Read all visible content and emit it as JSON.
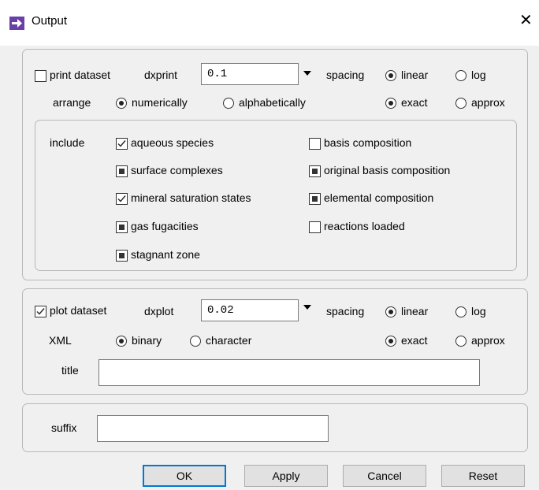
{
  "window": {
    "title": "Output",
    "close_glyph": "✕"
  },
  "print": {
    "checkbox_label": "print dataset",
    "checked": false,
    "dx_label": "dxprint",
    "dx_value": "0.1",
    "spacing_label": "spacing",
    "spacing_options": [
      "linear",
      "log"
    ],
    "spacing_selected": "linear",
    "arrange_label": "arrange",
    "arrange_options": [
      "numerically",
      "alphabetically"
    ],
    "arrange_selected": "numerically",
    "precision_options": [
      "exact",
      "approx"
    ],
    "precision_selected": "exact",
    "include_label": "include",
    "include_items": [
      {
        "label": "aqueous species",
        "state": "checked"
      },
      {
        "label": "basis composition",
        "state": "unchecked"
      },
      {
        "label": "surface complexes",
        "state": "filled"
      },
      {
        "label": "original basis composition",
        "state": "filled"
      },
      {
        "label": "mineral saturation states",
        "state": "checked"
      },
      {
        "label": "elemental composition",
        "state": "filled"
      },
      {
        "label": "gas fugacities",
        "state": "filled"
      },
      {
        "label": "reactions loaded",
        "state": "unchecked"
      },
      {
        "label": "stagnant zone",
        "state": "filled"
      }
    ]
  },
  "plot": {
    "checkbox_label": "plot dataset",
    "checked": true,
    "dx_label": "dxplot",
    "dx_value": "0.02",
    "spacing_label": "spacing",
    "spacing_options": [
      "linear",
      "log"
    ],
    "spacing_selected": "linear",
    "xml_label": "XML",
    "xml_options": [
      "binary",
      "character"
    ],
    "xml_selected": "binary",
    "precision_options": [
      "exact",
      "approx"
    ],
    "precision_selected": "exact",
    "title_label": "title",
    "title_value": ""
  },
  "suffix": {
    "label": "suffix",
    "value": ""
  },
  "buttons": {
    "ok": "OK",
    "apply": "Apply",
    "cancel": "Cancel",
    "reset": "Reset"
  },
  "colors": {
    "accent": "#0078d7",
    "app_icon": "#6b3fa8"
  }
}
